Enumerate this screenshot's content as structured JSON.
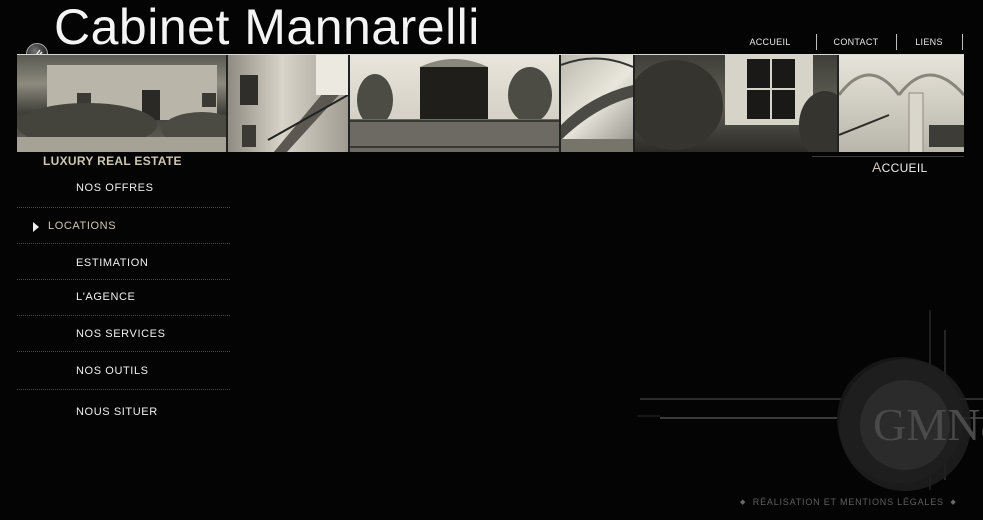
{
  "brand": {
    "name": "Cabinet Mannarelli",
    "tagline": "LUXURY REAL ESTATE"
  },
  "top_nav": [
    {
      "label": "ACCUEIL"
    },
    {
      "label": "CONTACT"
    },
    {
      "label": "LIENS"
    }
  ],
  "photos": [
    {
      "subject": "garden-house"
    },
    {
      "subject": "interior-staircase"
    },
    {
      "subject": "balcony-facade"
    },
    {
      "subject": "spiral-staircase"
    },
    {
      "subject": "ivy-window"
    },
    {
      "subject": "arched-hall"
    }
  ],
  "sidebar_menu": [
    {
      "label": "NOS OFFRES",
      "active": false
    },
    {
      "label": "LOCATIONS",
      "active": true
    },
    {
      "label": "ESTIMATION",
      "active": false
    },
    {
      "label": "L'AGENCE",
      "active": false
    },
    {
      "label": "NOS SERVICES",
      "active": false
    },
    {
      "label": "NOS OUTILS",
      "active": false
    },
    {
      "label": "NOUS SITUER",
      "active": false
    }
  ],
  "section": {
    "title_initial": "A",
    "title_rest": "CCUEIL"
  },
  "monogram": {
    "text": "GMN&"
  },
  "footer": {
    "diamond": "◆",
    "link": "RÉALISATION ET MENTIONS LÉGALES"
  },
  "colors": {
    "background": "#040404",
    "accent": "#cfc6b2",
    "text": "#f0f0f0"
  }
}
